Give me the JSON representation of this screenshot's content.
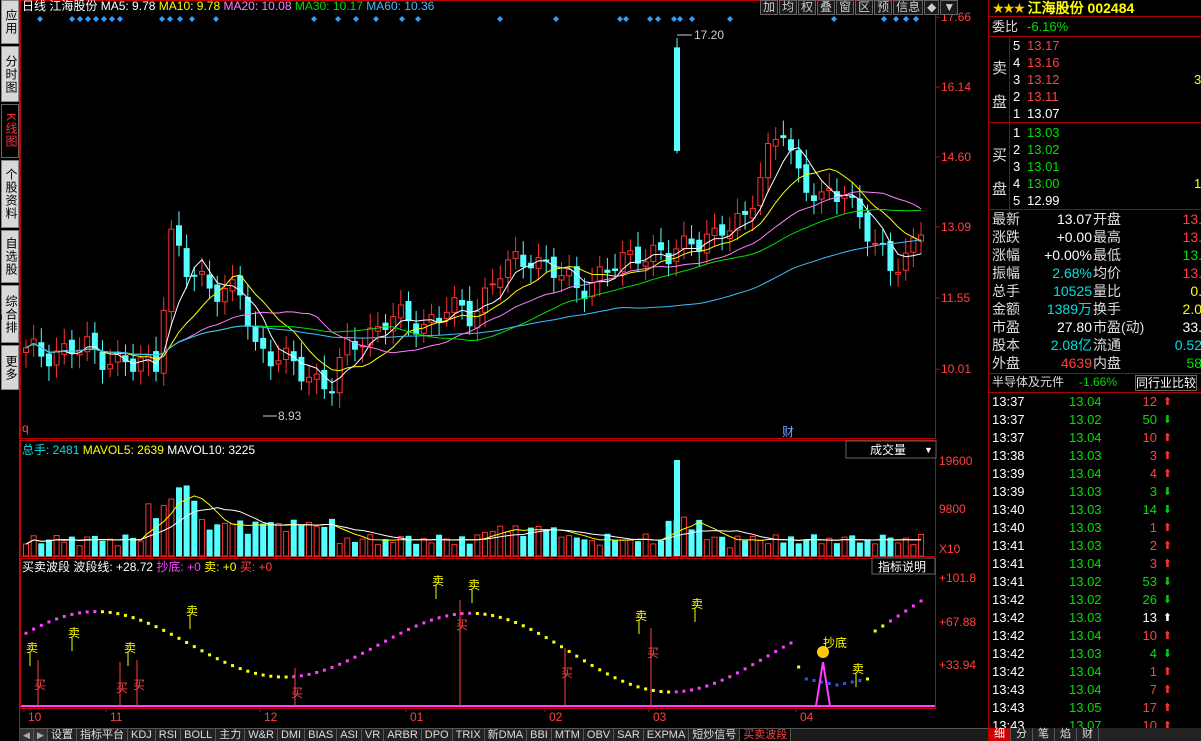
{
  "left_tabs": [
    {
      "label": "应用",
      "active": false
    },
    {
      "label": "分时图",
      "active": false
    },
    {
      "label": "K线图",
      "active": true
    },
    {
      "label": "个股资料",
      "active": false
    },
    {
      "label": "自选股",
      "active": false
    },
    {
      "label": "综合排名",
      "active": false
    },
    {
      "label": "更多",
      "active": false
    }
  ],
  "price_header": {
    "period": "日线",
    "stock": "江海股份",
    "ma5": "MA5: 9.78",
    "ma10": "MA10: 9.78",
    "ma20": "MA20: 10.08",
    "ma30": "MA30: 10.17",
    "ma60": "MA60: 10.36"
  },
  "top_buttons": [
    "加",
    "均",
    "权",
    "叠",
    "窗",
    "区",
    "预",
    "信息",
    "◆",
    "▼"
  ],
  "price_axis": [
    "17.66",
    "16.14",
    "14.60",
    "13.09",
    "11.55",
    "10.01"
  ],
  "price_annotations": {
    "high": "17.20",
    "low": "8.93",
    "cai": "财",
    "q": "q"
  },
  "volume_header": {
    "label": "总手: 2481",
    "mavol5": "MAVOL5: 2639",
    "mavol10": "MAVOL10: 3225",
    "selector": "成交量"
  },
  "volume_axis": [
    "19600",
    "9800",
    "X10"
  ],
  "indicator_header": {
    "name": "买卖波段",
    "line": "波段线: +28.72",
    "chaodi": "抄底: +0",
    "sell": "卖: +0",
    "buy": "买: +0",
    "help_button": "指标说明"
  },
  "indicator_axis": [
    "+101.8",
    "+67.88",
    "+33.94"
  ],
  "signals": {
    "sell": "卖",
    "buy": "买",
    "chaodi": "抄底"
  },
  "date_axis": [
    "10",
    "11",
    "12",
    "01",
    "02",
    "03",
    "04"
  ],
  "bottom_tabs": [
    "设置",
    "指标平台",
    "KDJ",
    "RSI",
    "BOLL",
    "主力",
    "W&R",
    "DMI",
    "BIAS",
    "ASI",
    "VR",
    "ARBR",
    "DPO",
    "TRIX",
    "新DMA",
    "BBI",
    "MTM",
    "OBV",
    "SAR",
    "EXPMA",
    "短炒信号",
    "买卖波段"
  ],
  "active_bottom_tab": "买卖波段",
  "colors": {
    "up": "#ff3232",
    "down": "#54ffff",
    "ma5": "#ffffff",
    "ma10": "#ffff00",
    "ma20": "#ff80ff",
    "ma30": "#00e000",
    "ma60": "#40c0ff",
    "axis": "#c00000"
  },
  "right_panel": {
    "title": "江海股份 002484",
    "weibi_label": "委比",
    "weibi_value": "-6.16%",
    "sell_label_top": "卖",
    "sell_label_bottom": "盘",
    "buy_label_top": "买",
    "buy_label_bottom": "盘",
    "asks": [
      {
        "level": "5",
        "price": "13.17",
        "vol": ""
      },
      {
        "level": "4",
        "price": "13.16",
        "vol": ""
      },
      {
        "level": "3",
        "price": "13.12",
        "vol": "3"
      },
      {
        "level": "2",
        "price": "13.11",
        "vol": ""
      },
      {
        "level": "1",
        "price": "13.07",
        "vol": ""
      }
    ],
    "bids": [
      {
        "level": "1",
        "price": "13.03",
        "vol": ""
      },
      {
        "level": "2",
        "price": "13.02",
        "vol": ""
      },
      {
        "level": "3",
        "price": "13.01",
        "vol": ""
      },
      {
        "level": "4",
        "price": "13.00",
        "vol": "1"
      },
      {
        "level": "5",
        "price": "12.99",
        "vol": ""
      }
    ],
    "stats": [
      {
        "l1": "最新",
        "v1": "13.07",
        "c1": "white",
        "l2": "开盘",
        "v2": "13.",
        "c2": "red"
      },
      {
        "l1": "涨跌",
        "v1": "+0.00",
        "c1": "white",
        "l2": "最高",
        "v2": "13.",
        "c2": "red"
      },
      {
        "l1": "涨幅",
        "v1": "+0.00%",
        "c1": "white",
        "l2": "最低",
        "v2": "13.",
        "c2": "green"
      },
      {
        "l1": "振幅",
        "v1": "2.68%",
        "c1": "cyan",
        "l2": "均价",
        "v2": "13.",
        "c2": "red"
      },
      {
        "l1": "总手",
        "v1": "10525",
        "c1": "cyan",
        "l2": "量比",
        "v2": "0.",
        "c2": "yellow"
      },
      {
        "l1": "金额",
        "v1": "1389万",
        "c1": "cyan",
        "l2": "换手",
        "v2": "2.0",
        "c2": "yellow"
      },
      {
        "l1": "市盈",
        "v1": "27.80",
        "c1": "white",
        "l2": "市盈(动)",
        "v2": "33.",
        "c2": "white"
      },
      {
        "l1": "股本",
        "v1": "2.08亿",
        "c1": "cyan",
        "l2": "流通",
        "v2": "0.52",
        "c2": "cyan"
      },
      {
        "l1": "外盘",
        "v1": "4639",
        "c1": "red",
        "l2": "内盘",
        "v2": "58",
        "c2": "green"
      }
    ],
    "sector": {
      "name": "半导体及元件",
      "change": "-1.66%",
      "compare": "同行业比较"
    },
    "ticks": [
      {
        "time": "13:37",
        "price": "13.04",
        "vol": "12",
        "dir": "up"
      },
      {
        "time": "13:37",
        "price": "13.02",
        "vol": "50",
        "dir": "down"
      },
      {
        "time": "13:37",
        "price": "13.04",
        "vol": "10",
        "dir": "up"
      },
      {
        "time": "13:38",
        "price": "13.03",
        "vol": "3",
        "dir": "up"
      },
      {
        "time": "13:39",
        "price": "13.04",
        "vol": "4",
        "dir": "up"
      },
      {
        "time": "13:39",
        "price": "13.03",
        "vol": "3",
        "dir": "down"
      },
      {
        "time": "13:40",
        "price": "13.03",
        "vol": "14",
        "dir": "down"
      },
      {
        "time": "13:40",
        "price": "13.03",
        "vol": "1",
        "dir": "up"
      },
      {
        "time": "13:41",
        "price": "13.03",
        "vol": "2",
        "dir": "up"
      },
      {
        "time": "13:41",
        "price": "13.04",
        "vol": "3",
        "dir": "up"
      },
      {
        "time": "13:41",
        "price": "13.02",
        "vol": "53",
        "dir": "down"
      },
      {
        "time": "13:42",
        "price": "13.02",
        "vol": "26",
        "dir": "down"
      },
      {
        "time": "13:42",
        "price": "13.03",
        "vol": "13",
        "dir": "white"
      },
      {
        "time": "13:42",
        "price": "13.04",
        "vol": "10",
        "dir": "up"
      },
      {
        "time": "13:42",
        "price": "13.03",
        "vol": "4",
        "dir": "down"
      },
      {
        "time": "13:42",
        "price": "13.04",
        "vol": "1",
        "dir": "up"
      },
      {
        "time": "13:43",
        "price": "13.04",
        "vol": "7",
        "dir": "up"
      },
      {
        "time": "13:43",
        "price": "13.05",
        "vol": "17",
        "dir": "up"
      },
      {
        "time": "13:43",
        "price": "13.07",
        "vol": "10",
        "dir": "up"
      }
    ],
    "bottom_tabs": [
      "细",
      "分",
      "笔",
      "焰",
      "财"
    ]
  }
}
